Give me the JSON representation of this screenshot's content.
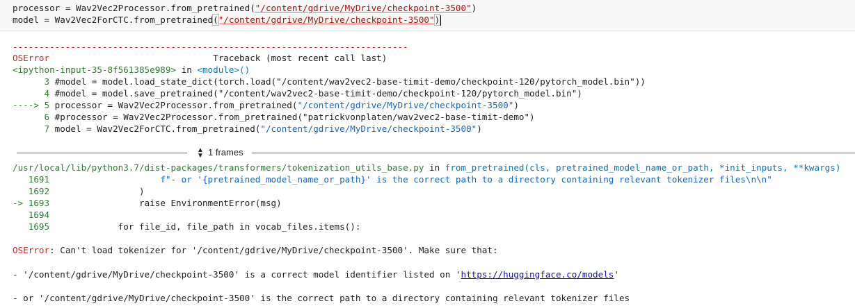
{
  "code_cell": {
    "line1_pre": "processor = Wav2Vec2Processor.from_pretrained(",
    "line1_str": "\"/content/gdrive/MyDrive/checkpoint-3500\"",
    "line1_post": ")",
    "line2_pre": "model = Wav2Vec2ForCTC.from_pretrained",
    "line2_paren_open": "(",
    "line2_str": "\"/content/gdrive/MyDrive/checkpoint-3500\"",
    "line2_paren_close": ")"
  },
  "traceback": {
    "dashes": "---------------------------------------------------------------------------",
    "error_type": "OSError",
    "header_right": "Traceback (most recent call last)",
    "input_ref": "<ipython-input-35-8f561385e989>",
    "in_word": " in ",
    "module_ref": "<module>()",
    "lines": [
      {
        "prefix": "      3 ",
        "text": "#model = model.load_state_dict(torch.load(\"/content/wav2vec2-base-timit-demo/checkpoint-120/pytorch_model.bin\"))"
      },
      {
        "prefix": "      4 ",
        "text": "#model = model.save_pretrained(\"/content/wav2vec2-base-timit-demo/checkpoint-120/pytorch_model.bin\")"
      },
      {
        "prefix": "----> 5 ",
        "text_pre": "processor = Wav2Vec2Processor.from_pretrained(",
        "text_str": "\"/content/gdrive/MyDrive/checkpoint-3500\"",
        "text_post": ")"
      },
      {
        "prefix": "      6 ",
        "text": "#processor = Wav2Vec2Processor.from_pretrained(\"patrickvonplaten/wav2vec2-base-timit-demo\")"
      },
      {
        "prefix": "      7 ",
        "text_pre": "model = Wav2Vec2ForCTC.from_pretrained(",
        "text_str": "\"/content/gdrive/MyDrive/checkpoint-3500\"",
        "text_post": ")"
      }
    ],
    "frames_label": "1 frames",
    "file_path": "/usr/local/lib/python3.7/dist-packages/transformers/tokenization_utils_base.py",
    "file_in": " in ",
    "func_sig": "from_pretrained(cls, pretrained_model_name_or_path, *init_inputs, **kwargs)",
    "src_lines": [
      {
        "num": "   1691 ",
        "code": "                    f\"- or '{pretrained_model_name_or_path}' is the correct path to a directory containing relevant tokenizer files\\n\\n\""
      },
      {
        "num": "   1692 ",
        "code": "                )"
      },
      {
        "num": "-> 1693 ",
        "code": "                raise EnvironmentError(msg)"
      },
      {
        "num": "   1694 ",
        "code": ""
      },
      {
        "num": "   1695 ",
        "code": "            for file_id, file_path in vocab_files.items():"
      }
    ],
    "final_error_type": "OSError",
    "final_msg": ": Can't load tokenizer for '/content/gdrive/MyDrive/checkpoint-3500'. Make sure that:",
    "bullet1_pre": "- '/content/gdrive/MyDrive/checkpoint-3500' is a correct model identifier listed on '",
    "bullet1_link": "https://huggingface.co/models",
    "bullet1_post": "'",
    "bullet2": "- or '/content/gdrive/MyDrive/checkpoint-3500' is the correct path to a directory containing relevant tokenizer files"
  },
  "colors": {
    "error_red": "#c62828",
    "lineno_green": "#2e7d32",
    "string_blue": "#1565c0",
    "link": "#1a0dab"
  },
  "icons": {
    "frames_toggle": "chevron-up-down-icon"
  }
}
